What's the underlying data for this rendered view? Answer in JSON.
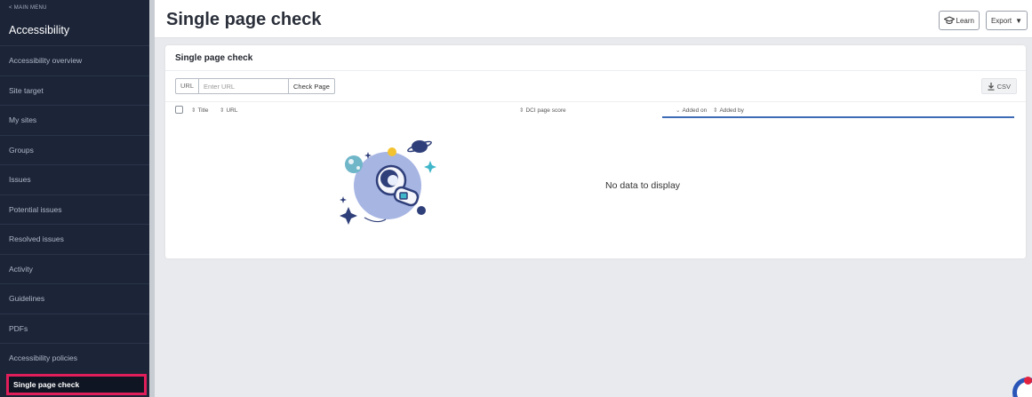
{
  "sidebar": {
    "back_label": "< MAIN MENU",
    "app_title": "Accessibility",
    "items": [
      {
        "label": "Accessibility overview"
      },
      {
        "label": "Site target"
      },
      {
        "label": "My sites"
      },
      {
        "label": "Groups"
      },
      {
        "label": "Issues"
      },
      {
        "label": "Potential issues"
      },
      {
        "label": "Resolved issues"
      },
      {
        "label": "Activity"
      },
      {
        "label": "Guidelines"
      },
      {
        "label": "PDFs"
      },
      {
        "label": "Accessibility policies"
      },
      {
        "label": "Single page check"
      }
    ],
    "active_index": 11,
    "active_outline_color": "#e01e5a"
  },
  "header": {
    "title": "Single page check",
    "learn_label": "Learn",
    "learn_icon": "graduation-cap-icon",
    "export_label": "Export",
    "export_icon": "caret-down-icon"
  },
  "card": {
    "title": "Single page check",
    "url_prefix": "URL",
    "url_placeholder": "Enter URL",
    "url_value": "",
    "check_button": "Check Page",
    "csv_label": "CSV",
    "csv_icon": "download-icon",
    "columns": [
      {
        "label": "Title",
        "sort": "unsorted"
      },
      {
        "label": "URL",
        "sort": "unsorted"
      },
      {
        "label": "DCI page score",
        "sort": "unsorted"
      },
      {
        "label": "Added on",
        "sort": "descending"
      },
      {
        "label": "Added by",
        "sort": "unsorted"
      }
    ],
    "empty_message": "No data to display",
    "empty_illustration": "astronaut-in-space-icon"
  },
  "colors": {
    "sidebar_bg": "#1c2538",
    "accent_blue": "#3e6bb5",
    "page_bg": "#e9eaed"
  }
}
